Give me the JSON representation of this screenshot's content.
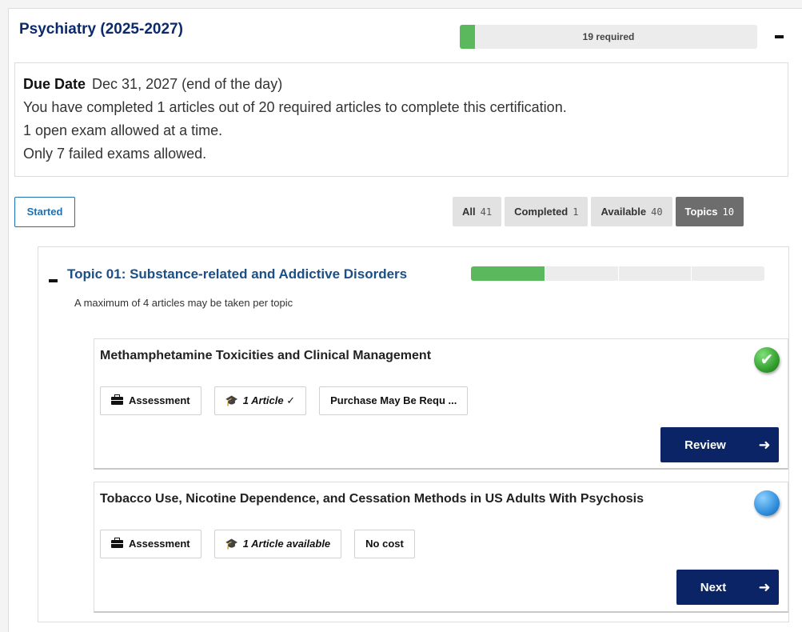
{
  "certification": {
    "title": "Psychiatry (2025-2027)",
    "progress_label": "19 required",
    "progress_fraction": 0.05,
    "due_date_label": "Due Date",
    "due_date_value": "Dec 31, 2027 (end of the day)",
    "completion_text": "You have completed 1 articles out of 20 required articles to complete this certification.",
    "open_exam_text": "1 open exam allowed at a time.",
    "failed_exam_text": "Only 7 failed exams allowed."
  },
  "status_button": "Started",
  "filters": [
    {
      "label": "All",
      "count": "41"
    },
    {
      "label": "Completed",
      "count": "1"
    },
    {
      "label": "Available",
      "count": "40"
    },
    {
      "label": "Topics",
      "count": "10"
    }
  ],
  "topic": {
    "title": "Topic 01: Substance-related and Addictive Disorders",
    "note": "A maximum of 4 articles may be taken per topic",
    "progress_fraction": 0.25
  },
  "articles": [
    {
      "title": "Methamphetamine Toxicities and Clinical Management",
      "status_icon": "completed-check-icon",
      "tags": [
        "Assessment",
        "1 Article ✓",
        "Purchase May Be Requ ..."
      ],
      "action": "Review"
    },
    {
      "title": "Tobacco Use, Nicotine Dependence, and Cessation Methods in US Adults With Psychosis",
      "status_icon": "available-dot-icon",
      "tags": [
        "Assessment",
        "1 Article available",
        "No cost"
      ],
      "action": "Next"
    }
  ],
  "colors": {
    "navy": "#0b2465",
    "title_blue": "#0b2a6b",
    "link_blue": "#1b4f86",
    "progress_green": "#5cb85c",
    "active_filter": "#6d6d6d"
  }
}
